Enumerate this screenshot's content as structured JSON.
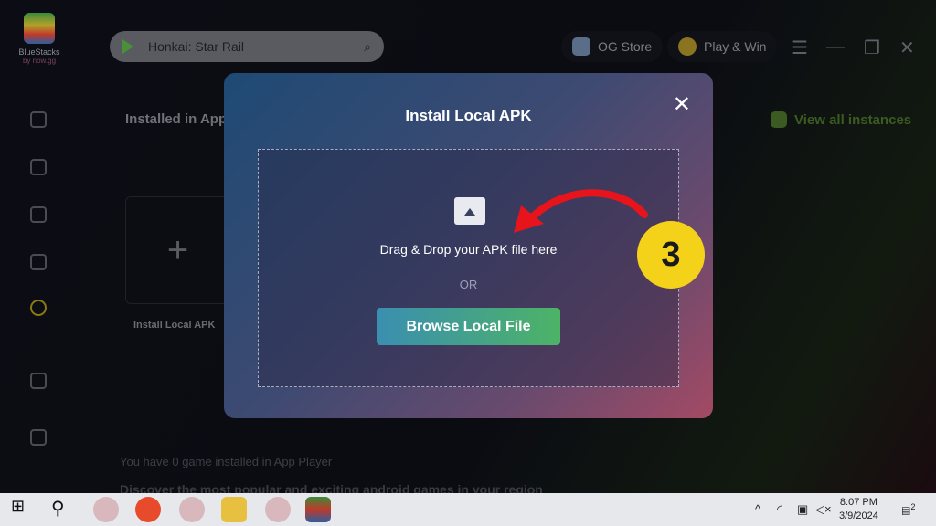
{
  "app": {
    "logo_text": "BlueStacks",
    "logo_sub": "by now.gg"
  },
  "search": {
    "value": "Honkai: Star Rail"
  },
  "header": {
    "og_store": "OG Store",
    "play_win": "Play & Win"
  },
  "main": {
    "heading": "Installed in App Player",
    "view_all": "View all instances",
    "add_label": "Install Local APK",
    "add_symbol": "+",
    "zero_games": "You have 0 game installed in App Player",
    "discover": "Discover the most popular and exciting android games in your region"
  },
  "modal": {
    "title": "Install Local APK",
    "close": "✕",
    "drop_text": "Drag & Drop your APK file here",
    "or": "OR",
    "browse": "Browse Local File"
  },
  "annotation": {
    "step": "3",
    "color": "#f5d21a",
    "arrow_color": "#e8141c"
  },
  "taskbar": {
    "time": "8:07 PM",
    "date": "3/9/2024",
    "notifications": "2"
  }
}
